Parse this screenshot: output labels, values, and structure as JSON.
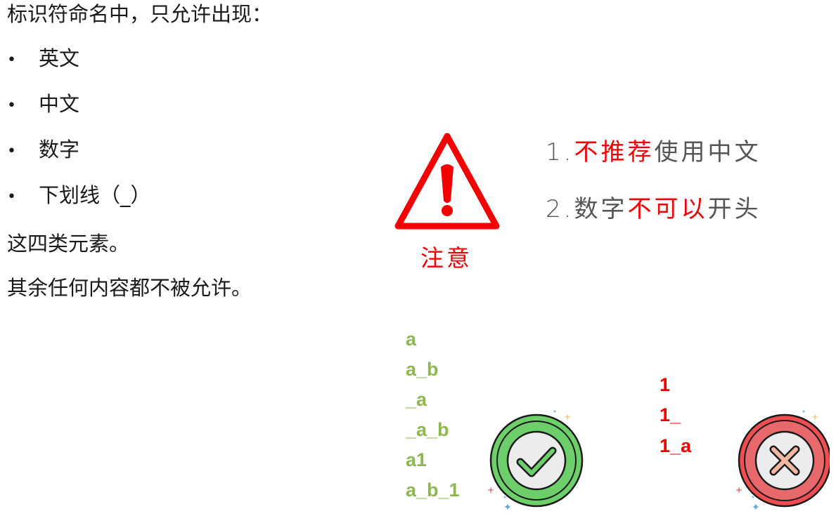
{
  "intro": "标识符命名中，只允许出现：",
  "allowed": [
    {
      "bullet": "•",
      "text": "英文"
    },
    {
      "bullet": "•",
      "text": "中文"
    },
    {
      "bullet": "•",
      "text": "数字"
    },
    {
      "bullet": "•",
      "text": "下划线（_）"
    }
  ],
  "summary": "这四类元素。",
  "others": "其余任何内容都不被允许。",
  "warning": {
    "label": "注意",
    "icon": "warning-triangle-icon",
    "color": "#f50000"
  },
  "rules": [
    {
      "num": "1.",
      "red": "不推荐",
      "rest": "使用中文"
    },
    {
      "num": "2.",
      "black": "数字",
      "red": "不可以",
      "rest": "开头"
    }
  ],
  "valid_examples": [
    "a",
    "a_b",
    "_a",
    "_a_b",
    "a1",
    "a_b_1"
  ],
  "invalid_examples": [
    "1",
    "1_",
    "1_a"
  ],
  "icons": {
    "valid": "check-circle-icon",
    "invalid": "cross-circle-icon"
  },
  "colors": {
    "valid": "#8cb84f",
    "invalid": "#f50000",
    "valid_badge": "#6ccf6a",
    "invalid_badge": "#ef4d4f"
  }
}
